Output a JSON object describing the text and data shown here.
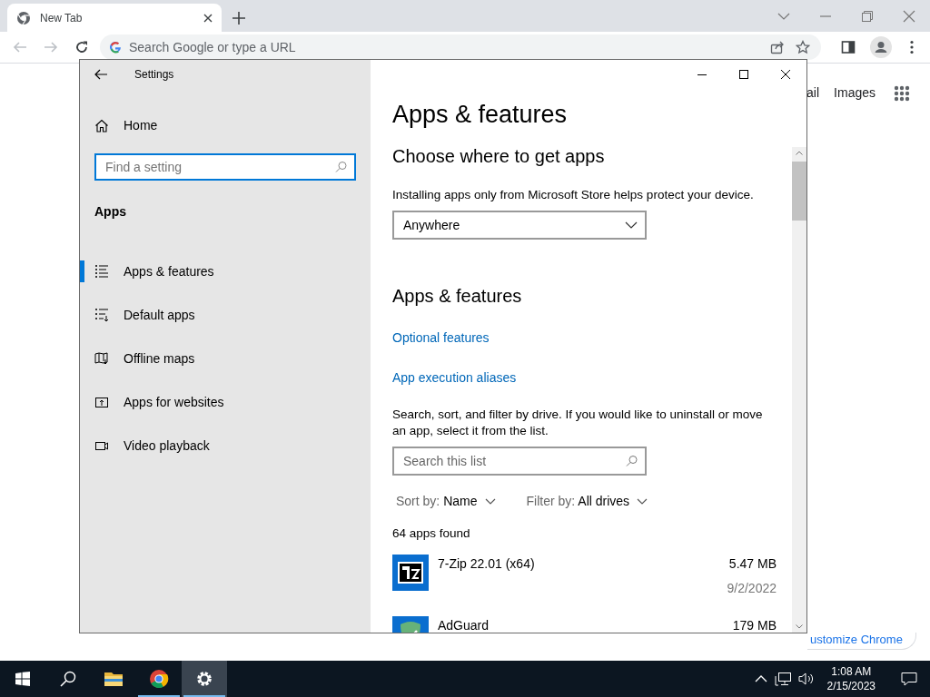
{
  "browser": {
    "tab": {
      "title": "New Tab",
      "selected": true
    },
    "toolbar": {
      "back": {
        "disabled": true
      },
      "forward": {
        "disabled": true
      }
    },
    "omnibox": {
      "placeholder": "Search Google or type a URL"
    },
    "page_links": [
      "ail",
      "Images"
    ],
    "customize_button": "ustomize Chrome"
  },
  "settings": {
    "title": "Settings",
    "home": "Home",
    "search": {
      "placeholder": "Find a setting",
      "focused": true
    },
    "section": "Apps",
    "nav": [
      {
        "label": "Apps & features",
        "selected": true
      },
      {
        "label": "Default apps",
        "selected": false
      },
      {
        "label": "Offline maps",
        "selected": false
      },
      {
        "label": "Apps for websites",
        "selected": false
      },
      {
        "label": "Video playback",
        "selected": false
      }
    ],
    "content": {
      "title": "Apps & features",
      "choose_heading": "Choose where to get apps",
      "choose_text": "Installing apps only from Microsoft Store helps protect your device.",
      "source_dropdown": {
        "value": "Anywhere"
      },
      "section_heading": "Apps & features",
      "links": [
        "Optional features",
        "App execution aliases"
      ],
      "search_text": "Search, sort, and filter by drive. If you would like to uninstall or move an app, select it from the list.",
      "list_search": {
        "placeholder": "Search this list"
      },
      "sort": {
        "label": "Sort by:",
        "value": "Name"
      },
      "filter": {
        "label": "Filter by:",
        "value": "All drives"
      },
      "count": "64 apps found",
      "apps": [
        {
          "kind": "sevenzip",
          "name": "7-Zip 22.01 (x64)",
          "size": "5.47 MB",
          "date": "9/2/2022"
        },
        {
          "kind": "adguard",
          "name": "AdGuard",
          "size": "179 MB"
        }
      ]
    }
  },
  "taskbar": {
    "apps": [
      {
        "kind": "explorer",
        "running": false,
        "active": false
      },
      {
        "kind": "chrome",
        "running": true,
        "active": false
      },
      {
        "kind": "settings",
        "running": true,
        "active": true
      }
    ],
    "time": "1:08 AM",
    "date": "2/15/2023"
  }
}
